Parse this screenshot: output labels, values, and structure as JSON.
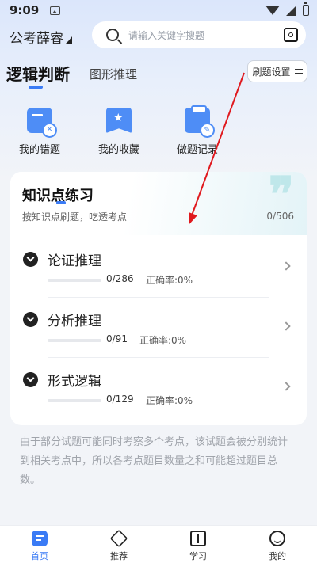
{
  "status_bar": {
    "time": "9:09"
  },
  "header": {
    "city": "公考薛睿",
    "search_placeholder": "请输入关键字搜题"
  },
  "tabs": [
    {
      "label": "逻辑判断",
      "active": true
    },
    {
      "label": "图形推理",
      "active": false
    }
  ],
  "settings_button": {
    "label": "刷题设置"
  },
  "quick_actions": [
    {
      "label": "我的错题",
      "icon": "wrong-questions-icon"
    },
    {
      "label": "我的收藏",
      "icon": "favorites-icon"
    },
    {
      "label": "做题记录",
      "icon": "record-icon"
    }
  ],
  "practice_card": {
    "title": "知识点练习",
    "subtitle": "按知识点刷题，吃透考点",
    "count": "0/506",
    "topics": [
      {
        "name": "论证推理",
        "count": "0/286",
        "accuracy": "正确率:0%",
        "progress": 0
      },
      {
        "name": "分析推理",
        "count": "0/91",
        "accuracy": "正确率:0%",
        "progress": 0
      },
      {
        "name": "形式逻辑",
        "count": "0/129",
        "accuracy": "正确率:0%",
        "progress": 0
      }
    ]
  },
  "note": "由于部分试题可能同时考察多个考点，该试题会被分别统计到相关考点中，所以各考点题目数量之和可能超过题目总数。",
  "bottom_nav": [
    {
      "label": "首页",
      "icon": "home-icon",
      "active": true
    },
    {
      "label": "推荐",
      "icon": "graduation-cap-icon",
      "active": false
    },
    {
      "label": "学习",
      "icon": "book-icon",
      "active": false
    },
    {
      "label": "我的",
      "icon": "profile-icon",
      "active": false
    }
  ],
  "colors": {
    "accent": "#3a7bf5",
    "annotation_arrow": "#e0191e"
  }
}
